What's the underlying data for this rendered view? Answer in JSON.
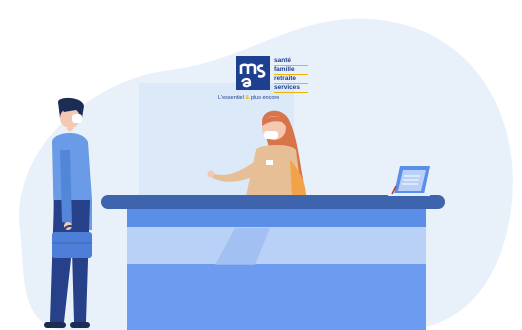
{
  "logo": {
    "mark": "msa",
    "lines": [
      "santé",
      "famille",
      "retraite",
      "services"
    ],
    "tagline_before": "L'essentiel",
    "tagline_amp": "&",
    "tagline_after": "plus encore",
    "colors": {
      "brand_blue": "#1d3f8f",
      "brand_yellow": "#f0b400"
    }
  },
  "scene": {
    "description_icons": [
      "customer-figure",
      "receptionist-figure",
      "reception-desk",
      "laptop-icon",
      "plexiglass-screen",
      "briefcase-icon"
    ],
    "colors": {
      "backdrop": "#e8f0fa",
      "desk_top": "#3d64ac",
      "desk_front": "#6c9bf0",
      "desk_panel": "#b9d1f7",
      "customer_shirt": "#6a9be6",
      "customer_pants": "#27408a",
      "receptionist_top": "#e6bf96",
      "receptionist_hair": "#d9734a"
    }
  }
}
